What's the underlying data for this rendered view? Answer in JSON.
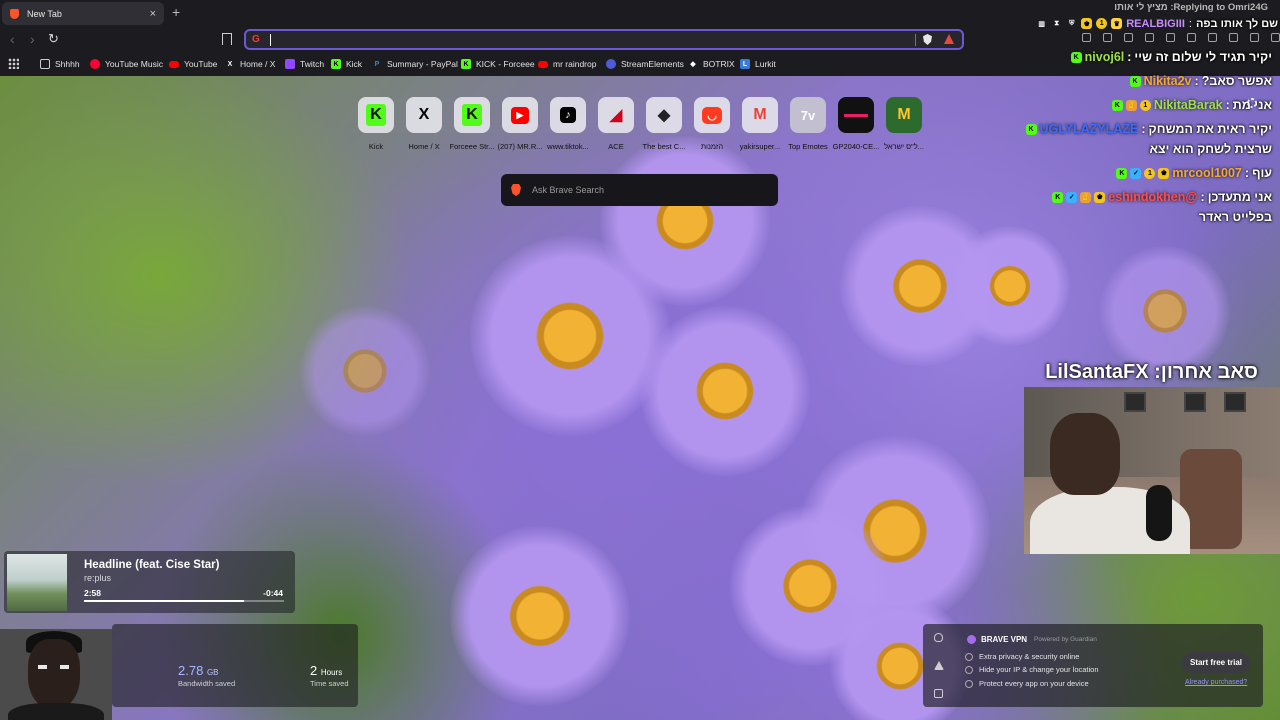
{
  "browser": {
    "tab_title": "New Tab",
    "tab_close": "×",
    "new_tab": "+",
    "address_value": "",
    "search_engine_icon": "G"
  },
  "bookmarks": [
    {
      "label": "Shhhh",
      "icon": "folder-icon",
      "color": "#cccccc"
    },
    {
      "label": "YouTube Music",
      "icon": "youtube-music-icon",
      "color": "#ff0033"
    },
    {
      "label": "YouTube",
      "icon": "youtube-icon",
      "color": "#ff0000"
    },
    {
      "label": "Home / X",
      "icon": "x-icon",
      "color": "#ffffff"
    },
    {
      "label": "Twitch",
      "icon": "twitch-icon",
      "color": "#9146ff"
    },
    {
      "label": "Kick",
      "icon": "kick-icon",
      "color": "#53fc18"
    },
    {
      "label": "Summary - PayPal",
      "icon": "paypal-icon",
      "color": "#2790c3"
    },
    {
      "label": "KICK - Forceee",
      "icon": "kick-icon",
      "color": "#53fc18"
    },
    {
      "label": "mr raindrop",
      "icon": "youtube-icon",
      "color": "#ff0000"
    },
    {
      "label": "StreamElements",
      "icon": "streamelements-icon",
      "color": "#4d5bd8"
    },
    {
      "label": "BOTRIX",
      "icon": "botrix-icon",
      "color": "#ffffff"
    },
    {
      "label": "Lurkit",
      "icon": "lurkit-icon",
      "color": "#3a7bd5"
    }
  ],
  "top_sites": [
    {
      "label": "Kick",
      "glyph": "K",
      "color": "#53fc18"
    },
    {
      "label": "Home / X",
      "glyph": "X",
      "color": "#000000"
    },
    {
      "label": "Forceee Str...",
      "glyph": "K",
      "color": "#53fc18"
    },
    {
      "label": "(207) MR.R...",
      "glyph": "▶",
      "color": "#ff0000"
    },
    {
      "label": "www.tiktok...",
      "glyph": "♪",
      "color": "#000000"
    },
    {
      "label": "ACE",
      "glyph": "◢",
      "color": "#d0021b"
    },
    {
      "label": "The best C...",
      "glyph": "◆",
      "color": "#333333"
    },
    {
      "label": "הזמנות",
      "glyph": "◡",
      "color": "#ff3b1f"
    },
    {
      "label": "yakirsuper...",
      "glyph": "M",
      "color": "#ea4335"
    },
    {
      "label": "Top Emotes",
      "glyph": "7v",
      "color": "#29b6f6"
    },
    {
      "label": "GP2040-CE...",
      "glyph": "▬",
      "color": "#e91e63"
    },
    {
      "label": "ל\"ס ישראל...",
      "glyph": "M",
      "color": "#ffc72c"
    }
  ],
  "brave_search": {
    "placeholder": "Ask Brave Search"
  },
  "chat": {
    "reply_header": "Replying to Omri24G: מציץ לי אותו",
    "reply_user": "REALBIGIII",
    "reply_text": "שם לך אותו בפה",
    "messages": [
      {
        "user": "nivoj6l",
        "color": "#9fe04a",
        "text": "יקיר תגיד לי שלום זה שיי"
      },
      {
        "user": "Nikita2v",
        "color": "#f0a838",
        "text": "אפשר סאב?"
      },
      {
        "user": "NikitaBarak",
        "color": "#9fe04a",
        "text": "אני מת"
      },
      {
        "user": "UGLYLAZYLAZE",
        "color": "#3a6bff",
        "text": "יקיר ראית את המשחק"
      },
      {
        "user": "",
        "color": "#ffffff",
        "text": "שרצית לשחק הוא יצא"
      },
      {
        "user": "mrcool1007",
        "color": "#f0a838",
        "text": "עוף"
      },
      {
        "user": "@eshindokhen",
        "color": "#ff4d4d",
        "text": "אני מתעדכן"
      },
      {
        "user": "",
        "color": "#ffffff",
        "text": "בפלייט ראדר"
      }
    ]
  },
  "last_sub": "סאב אחרון: LilSantaFX",
  "media": {
    "title": "Headline (feat. Cise Star)",
    "artist": "re:plus",
    "elapsed": "2:58",
    "remaining": "-0:44",
    "progress": 0.8
  },
  "stats": {
    "bandwidth_value": "2.78",
    "bandwidth_unit": "GB",
    "bandwidth_label": "Bandwidth saved",
    "time_value": "2",
    "time_unit": "Hours",
    "time_label": "Time saved"
  },
  "vpn": {
    "name": "BRAVE VPN",
    "powered": "Powered by Guardian",
    "features": [
      "Extra privacy & security online",
      "Hide your IP & change your location",
      "Protect every app on your device"
    ],
    "cta": "Start free trial",
    "link": "Already purchased?"
  }
}
